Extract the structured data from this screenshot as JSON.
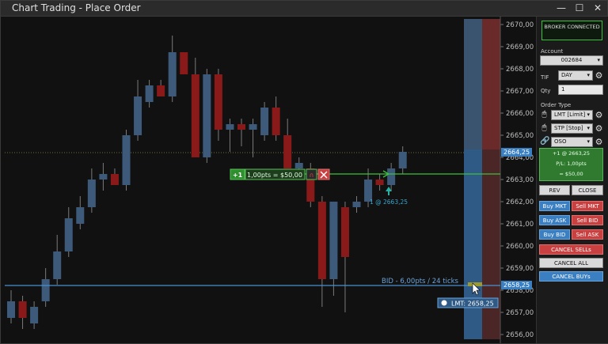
{
  "window": {
    "title": "Chart Trading - Place Order",
    "minimize": "—",
    "maximize": "☐",
    "close": "✕"
  },
  "panel": {
    "status": "BROKER CONNECTED",
    "account_label": "Account",
    "account_value": "002684",
    "tif_label": "TIF",
    "tif_value": "DAY",
    "qty_label": "Qty",
    "qty_value": "1",
    "order_type_label": "Order Type",
    "order_types": [
      "LMT [Limit]",
      "STP [Stop]",
      "OSO"
    ],
    "position": {
      "line1": "+1 @ 2663,25",
      "line2": "P/L: 1,00pts",
      "line3": "= $50,00"
    },
    "buttons": {
      "rev": "REV",
      "close": "CLOSE",
      "buy_mkt": "Buy MKT",
      "sell_mkt": "Sell MKT",
      "buy_ask": "Buy ASK",
      "sell_bid": "Sell BID",
      "buy_bid": "Buy BID",
      "sell_ask": "Sell ASK",
      "cancel_sells": "CANCEL SELLs",
      "cancel_all": "CANCEL ALL",
      "cancel_buys": "CANCEL BUYs"
    }
  },
  "chart": {
    "position_line": {
      "qty": "+1",
      "pnl": "1,00pts = $50,00"
    },
    "fill_label": "1 @ 2663,25",
    "bid_label": "BID - 6,00pts / 24 ticks",
    "lmt_label": "LMT: 2658,25",
    "price_tags": {
      "last": "2664,25",
      "bid": "2658,25"
    },
    "colors": {
      "bull": "#3d5a7a",
      "bear": "#8a1a1a",
      "position_line": "#3fbf3f",
      "bid_line": "#4a90d0"
    }
  },
  "chart_data": {
    "type": "candlestick",
    "y_ticks": [
      "2670,00",
      "2669,00",
      "2668,00",
      "2667,00",
      "2666,00",
      "2665,00",
      "2664,00",
      "2663,00",
      "2662,00",
      "2661,00",
      "2660,00",
      "2659,00",
      "2658,00",
      "2657,00",
      "2656,00"
    ],
    "ylim": [
      2655.75,
      2670.25
    ],
    "candles": [
      {
        "o": 2656.75,
        "h": 2658.0,
        "l": 2656.5,
        "c": 2657.5
      },
      {
        "o": 2657.5,
        "h": 2657.75,
        "l": 2656.25,
        "c": 2656.75
      },
      {
        "o": 2656.5,
        "h": 2657.5,
        "l": 2656.25,
        "c": 2657.25
      },
      {
        "o": 2657.5,
        "h": 2659.0,
        "l": 2657.25,
        "c": 2658.5
      },
      {
        "o": 2658.5,
        "h": 2660.5,
        "l": 2658.25,
        "c": 2659.75
      },
      {
        "o": 2659.75,
        "h": 2661.75,
        "l": 2659.5,
        "c": 2661.25
      },
      {
        "o": 2661.0,
        "h": 2662.25,
        "l": 2660.75,
        "c": 2661.75
      },
      {
        "o": 2661.75,
        "h": 2663.5,
        "l": 2661.5,
        "c": 2663.0
      },
      {
        "o": 2663.0,
        "h": 2663.75,
        "l": 2662.5,
        "c": 2663.25
      },
      {
        "o": 2663.25,
        "h": 2663.5,
        "l": 2662.75,
        "c": 2662.75
      },
      {
        "o": 2662.75,
        "h": 2665.25,
        "l": 2662.5,
        "c": 2665.0
      },
      {
        "o": 2665.0,
        "h": 2667.5,
        "l": 2664.75,
        "c": 2666.75
      },
      {
        "o": 2666.5,
        "h": 2667.5,
        "l": 2666.25,
        "c": 2667.25
      },
      {
        "o": 2667.25,
        "h": 2667.5,
        "l": 2666.75,
        "c": 2666.75
      },
      {
        "o": 2666.75,
        "h": 2669.5,
        "l": 2666.5,
        "c": 2668.75
      },
      {
        "o": 2668.75,
        "h": 2668.75,
        "l": 2667.75,
        "c": 2667.75
      },
      {
        "o": 2667.75,
        "h": 2668.5,
        "l": 2664.0,
        "c": 2664.0
      },
      {
        "o": 2664.0,
        "h": 2668.0,
        "l": 2663.75,
        "c": 2667.75
      },
      {
        "o": 2667.75,
        "h": 2668.0,
        "l": 2664.75,
        "c": 2665.25
      },
      {
        "o": 2665.25,
        "h": 2665.75,
        "l": 2664.25,
        "c": 2665.5
      },
      {
        "o": 2665.5,
        "h": 2665.75,
        "l": 2664.5,
        "c": 2665.25
      },
      {
        "o": 2665.25,
        "h": 2665.75,
        "l": 2664.0,
        "c": 2665.5
      },
      {
        "o": 2665.0,
        "h": 2666.5,
        "l": 2664.75,
        "c": 2666.25
      },
      {
        "o": 2666.25,
        "h": 2666.75,
        "l": 2664.75,
        "c": 2665.0
      },
      {
        "o": 2665.0,
        "h": 2665.75,
        "l": 2663.5,
        "c": 2663.5
      },
      {
        "o": 2663.5,
        "h": 2664.0,
        "l": 2663.0,
        "c": 2663.75
      },
      {
        "o": 2663.5,
        "h": 2663.75,
        "l": 2661.75,
        "c": 2662.0
      },
      {
        "o": 2662.0,
        "h": 2662.25,
        "l": 2657.25,
        "c": 2658.5
      },
      {
        "o": 2658.5,
        "h": 2662.0,
        "l": 2657.75,
        "c": 2662.0
      },
      {
        "o": 2661.75,
        "h": 2662.0,
        "l": 2657.0,
        "c": 2659.5
      },
      {
        "o": 2661.75,
        "h": 2662.25,
        "l": 2661.5,
        "c": 2662.0
      },
      {
        "o": 2662.0,
        "h": 2663.5,
        "l": 2661.75,
        "c": 2663.0
      },
      {
        "o": 2663.0,
        "h": 2663.25,
        "l": 2662.5,
        "c": 2662.75
      },
      {
        "o": 2662.75,
        "h": 2663.75,
        "l": 2662.5,
        "c": 2663.5
      },
      {
        "o": 2663.5,
        "h": 2664.5,
        "l": 2663.25,
        "c": 2664.25
      }
    ]
  }
}
